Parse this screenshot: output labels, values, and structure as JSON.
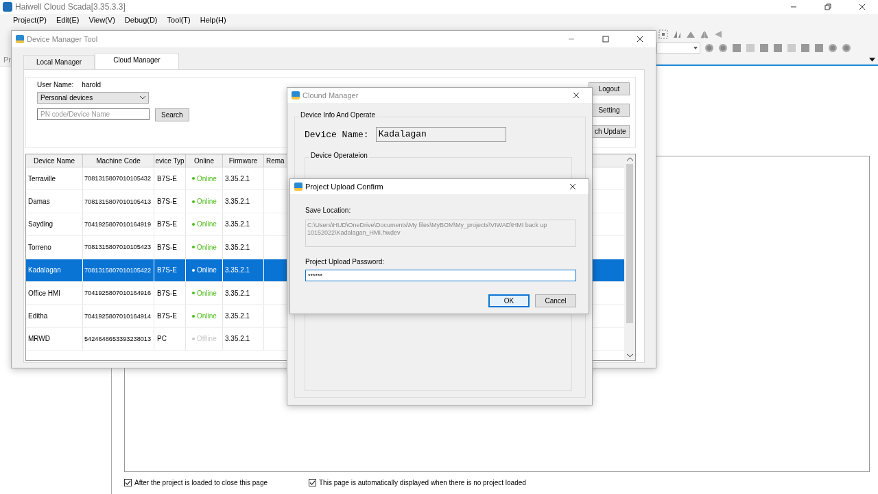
{
  "app": {
    "title": "Haiwell Cloud Scada[3.35.3.3]",
    "menu": [
      "Project(P)",
      "Edit(E)",
      "View(V)",
      "Debug(D)",
      "Tool(T)",
      "Help(H)"
    ],
    "panel_tab": "Pr",
    "start_page": {
      "options": [
        {
          "label": "After the project is loaded to close this page",
          "checked": true
        },
        {
          "label": "This page is automatically displayed when there is no project loaded",
          "checked": true
        }
      ]
    }
  },
  "device_manager": {
    "title": "Device Manager Tool",
    "tabs": [
      {
        "label": "Local Manager",
        "selected": false
      },
      {
        "label": "Cloud Manager",
        "selected": true
      }
    ],
    "user_label": "User Name:",
    "user_name": "harold",
    "device_filter": "Personal devices",
    "search": {
      "placeholder": "PN code/Device Name"
    },
    "search_button": "Search",
    "buttons": [
      "Logout",
      "Setting",
      "ch Update"
    ],
    "table": {
      "columns": [
        "Device Name",
        "Machine Code",
        "evice Typ",
        "Online",
        "Firmware",
        "Rema"
      ],
      "rows": [
        {
          "name": "Terraville",
          "code": "7081315807010105432",
          "type": "B7S-E",
          "online": true,
          "status": "Online",
          "firmware": "3.35.2.1",
          "selected": false
        },
        {
          "name": "Damas",
          "code": "7081315807010105413",
          "type": "B7S-E",
          "online": true,
          "status": "Online",
          "firmware": "3.35.2.1",
          "selected": false
        },
        {
          "name": "Sayding",
          "code": "7041925807010164919",
          "type": "B7S-E",
          "online": true,
          "status": "Online",
          "firmware": "3.35.2.1",
          "selected": false
        },
        {
          "name": "Torreno",
          "code": "7081315807010105423",
          "type": "B7S-E",
          "online": true,
          "status": "Online",
          "firmware": "3.35.2.1",
          "selected": false
        },
        {
          "name": "Kadalagan",
          "code": "7081315807010105422",
          "type": "B7S-E",
          "online": true,
          "status": "Online",
          "firmware": "3.35.2.1",
          "selected": true
        },
        {
          "name": "Office HMI",
          "code": "7041925807010164916",
          "type": "B7S-E",
          "online": true,
          "status": "Online",
          "firmware": "3.35.2.1",
          "selected": false
        },
        {
          "name": "Editha",
          "code": "7041925807010164914",
          "type": "B7S-E",
          "online": true,
          "status": "Online",
          "firmware": "3.35.2.1",
          "selected": false
        },
        {
          "name": "MRWD",
          "code": "5424648653393238013",
          "type": "PC",
          "online": false,
          "status": "Offline",
          "firmware": "3.35.2.1",
          "selected": false
        }
      ]
    }
  },
  "cloud_manager": {
    "title": "Clound Manager",
    "group": "Device Info And Operate",
    "device_name_label": "Device Name:",
    "device_name": "Kadalagan",
    "subgroup": "Device Operateion"
  },
  "upload_confirm": {
    "title": "Project Upload Confirm",
    "save_location_label": "Save Location:",
    "save_location": "C:\\Users\\HUD\\OneDrive\\Documents\\My files\\MyBOM\\My_projects\\VIWAD\\HMI back up 10152022\\Kadalagan_HMI.hwdev",
    "password_label": "Project Upload Password:",
    "password": "******",
    "buttons": [
      {
        "label": "OK",
        "kind": "default"
      },
      {
        "label": "Cancel",
        "kind": "normal"
      }
    ]
  }
}
